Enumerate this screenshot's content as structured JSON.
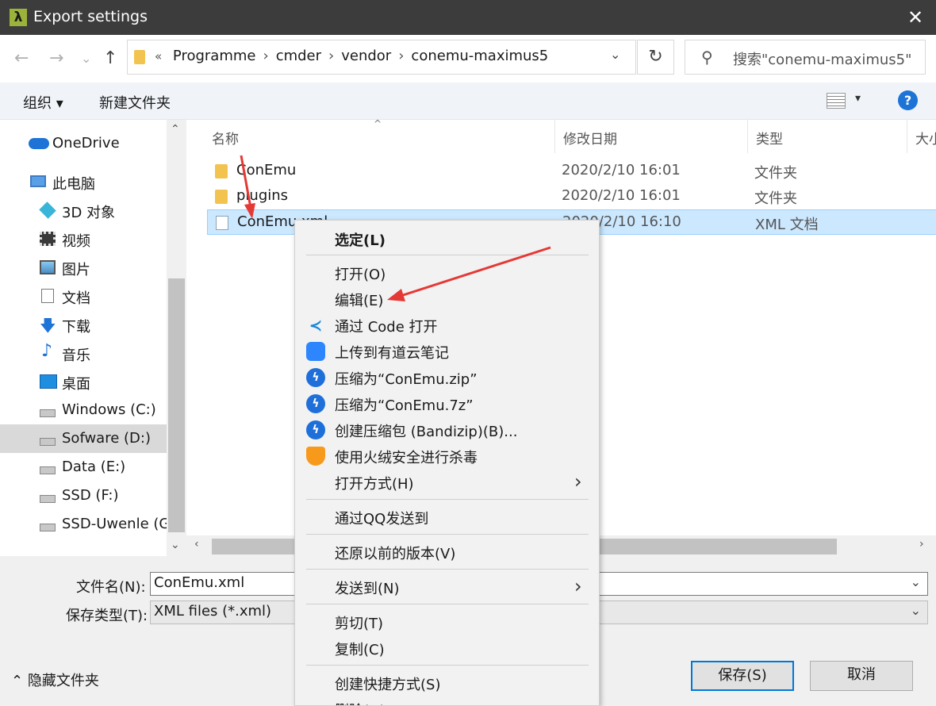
{
  "window": {
    "title": "Export settings",
    "app_icon": "λ"
  },
  "nav": {
    "back": "←",
    "forward": "→",
    "recent": "⌄",
    "up": "↑",
    "address_prefix": "«",
    "breadcrumbs": [
      "Programme",
      "cmder",
      "vendor",
      "conemu-maximus5"
    ],
    "search_placeholder": "搜索\"conemu-maximus5\""
  },
  "toolbar": {
    "organize": "组织 ▾",
    "new_folder": "新建文件夹"
  },
  "sidebar": {
    "items": [
      {
        "label": "OneDrive",
        "icon": "cloud-icon"
      },
      {
        "label": "此电脑",
        "icon": "computer-icon"
      },
      {
        "label": "3D 对象",
        "icon": "cube-icon"
      },
      {
        "label": "视频",
        "icon": "video-icon"
      },
      {
        "label": "图片",
        "icon": "picture-icon"
      },
      {
        "label": "文档",
        "icon": "document-icon"
      },
      {
        "label": "下载",
        "icon": "download-icon"
      },
      {
        "label": "音乐",
        "icon": "music-icon"
      },
      {
        "label": "桌面",
        "icon": "desktop-icon"
      },
      {
        "label": "Windows (C:)",
        "icon": "drive-icon"
      },
      {
        "label": "Sofware (D:)",
        "icon": "drive-icon"
      },
      {
        "label": "Data (E:)",
        "icon": "drive-icon"
      },
      {
        "label": "SSD (F:)",
        "icon": "drive-icon"
      },
      {
        "label": "SSD-Uwenle (G:",
        "icon": "drive-icon"
      }
    ]
  },
  "filelist": {
    "columns": [
      "名称",
      "修改日期",
      "类型",
      "大小"
    ],
    "rows": [
      {
        "name": "ConEmu",
        "date": "2020/2/10 16:01",
        "type": "文件夹"
      },
      {
        "name": "plugins",
        "date": "2020/2/10 16:01",
        "type": "文件夹"
      },
      {
        "name": "ConEmu.xml",
        "date": "2020/2/10 16:10",
        "type": "XML 文档"
      }
    ]
  },
  "form": {
    "filename_label": "文件名(N):",
    "filename_value": "ConEmu.xml",
    "filetype_label": "保存类型(T):",
    "filetype_value": "XML files (*.xml)",
    "hide_folders": "隐藏文件夹",
    "save": "保存(S)",
    "cancel": "取消"
  },
  "context_menu": {
    "items": {
      "select": "选定(L)",
      "open": "打开(O)",
      "edit": "编辑(E)",
      "open_code": "通过 Code 打开",
      "youdao": "上传到有道云笔记",
      "zip": "压缩为“ConEmu.zip”",
      "sevenz": "压缩为“ConEmu.7z”",
      "bandizip": "创建压缩包 (Bandizip)(B)...",
      "huorong": "使用火绒安全进行杀毒",
      "open_with": "打开方式(H)",
      "qq": "通过QQ发送到",
      "restore": "还原以前的版本(V)",
      "send_to": "发送到(N)",
      "cut": "剪切(T)",
      "copy": "复制(C)",
      "shortcut": "创建快捷方式(S)",
      "delete": "删除(D)"
    }
  },
  "colors": {
    "accent": "#0078d7",
    "annotation_arrow": "#e53935",
    "selection": "#cce8ff"
  }
}
